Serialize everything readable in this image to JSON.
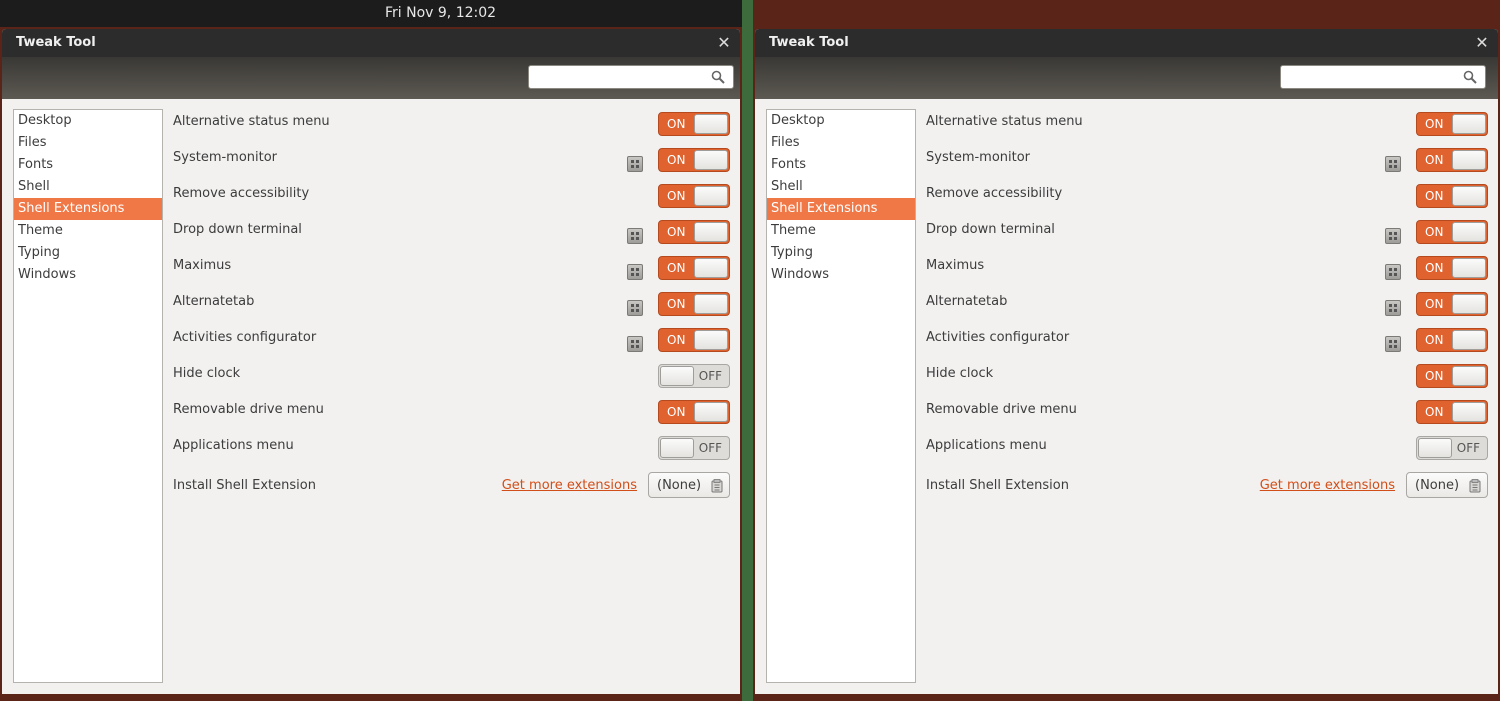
{
  "top_bar": {
    "clock": "Fri Nov  9, 12:02"
  },
  "window": {
    "title": "Tweak Tool",
    "close_glyph": "✕",
    "search_placeholder": ""
  },
  "sidebar": {
    "items": [
      {
        "label": "Desktop"
      },
      {
        "label": "Files"
      },
      {
        "label": "Fonts"
      },
      {
        "label": "Shell"
      },
      {
        "label": "Shell Extensions",
        "selected": true
      },
      {
        "label": "Theme"
      },
      {
        "label": "Typing"
      },
      {
        "label": "Windows"
      }
    ]
  },
  "left": {
    "rows": [
      {
        "label": "Alternative status menu",
        "state": "ON",
        "settings": false
      },
      {
        "label": "System-monitor",
        "state": "ON",
        "settings": true
      },
      {
        "label": "Remove accessibility",
        "state": "ON",
        "settings": false
      },
      {
        "label": "Drop down terminal",
        "state": "ON",
        "settings": true
      },
      {
        "label": "Maximus",
        "state": "ON",
        "settings": true
      },
      {
        "label": "Alternatetab",
        "state": "ON",
        "settings": true
      },
      {
        "label": "Activities configurator",
        "state": "ON",
        "settings": true
      },
      {
        "label": "Hide clock",
        "state": "OFF",
        "settings": false
      },
      {
        "label": "Removable drive menu",
        "state": "ON",
        "settings": false
      },
      {
        "label": "Applications menu",
        "state": "OFF",
        "settings": false
      }
    ],
    "install": {
      "label": "Install Shell Extension",
      "link": "Get more extensions",
      "file_value": "(None)"
    }
  },
  "right": {
    "rows": [
      {
        "label": "Alternative status menu",
        "state": "ON",
        "settings": false
      },
      {
        "label": "System-monitor",
        "state": "ON",
        "settings": true
      },
      {
        "label": "Remove accessibility",
        "state": "ON",
        "settings": false
      },
      {
        "label": "Drop down terminal",
        "state": "ON",
        "settings": true
      },
      {
        "label": "Maximus",
        "state": "ON",
        "settings": true
      },
      {
        "label": "Alternatetab",
        "state": "ON",
        "settings": true
      },
      {
        "label": "Activities configurator",
        "state": "ON",
        "settings": true
      },
      {
        "label": "Hide clock",
        "state": "ON",
        "settings": false
      },
      {
        "label": "Removable drive menu",
        "state": "ON",
        "settings": false
      },
      {
        "label": "Applications menu",
        "state": "OFF",
        "settings": false
      }
    ],
    "install": {
      "label": "Install Shell Extension",
      "link": "Get more extensions",
      "file_value": "(None)"
    }
  },
  "colors": {
    "accent": "#e0622e",
    "link": "#d24e18",
    "selection": "#f07746",
    "titlebar": "#2c2c2c",
    "divider": "#3d6b3b"
  }
}
